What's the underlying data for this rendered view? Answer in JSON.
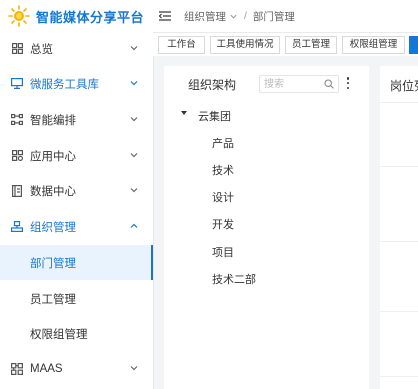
{
  "app": {
    "title": "智能媒体分享平台"
  },
  "sidebar": {
    "items": [
      {
        "label": "总览",
        "icon": "grid-icon"
      },
      {
        "label": "微服务工具库",
        "icon": "monitor-icon"
      },
      {
        "label": "智能编排",
        "icon": "flow-icon"
      },
      {
        "label": "应用中心",
        "icon": "apps-icon"
      },
      {
        "label": "数据中心",
        "icon": "data-icon"
      },
      {
        "label": "组织管理",
        "icon": "org-icon"
      },
      {
        "label": "MAAS",
        "icon": "maas-icon"
      }
    ],
    "sub_items": [
      {
        "label": "部门管理"
      },
      {
        "label": "员工管理"
      },
      {
        "label": "权限组管理"
      }
    ]
  },
  "breadcrumb": {
    "parent": "组织管理",
    "separator": "/",
    "current": "部门管理"
  },
  "tabs": [
    {
      "label": "工作台"
    },
    {
      "label": "工具使用情况"
    },
    {
      "label": "员工管理"
    },
    {
      "label": "权限组管理"
    },
    {
      "label": ""
    }
  ],
  "org_panel": {
    "title": "组织架构",
    "search_placeholder": "搜索",
    "root": "云集团",
    "children": [
      "产品",
      "技术",
      "设计",
      "开发",
      "项目",
      "技术二部"
    ]
  },
  "right_panel": {
    "title_partial": "岗位列"
  },
  "colors": {
    "accent": "#1677d2",
    "active_bg": "#e9f3fd",
    "logo_sun": "#f5b400"
  }
}
